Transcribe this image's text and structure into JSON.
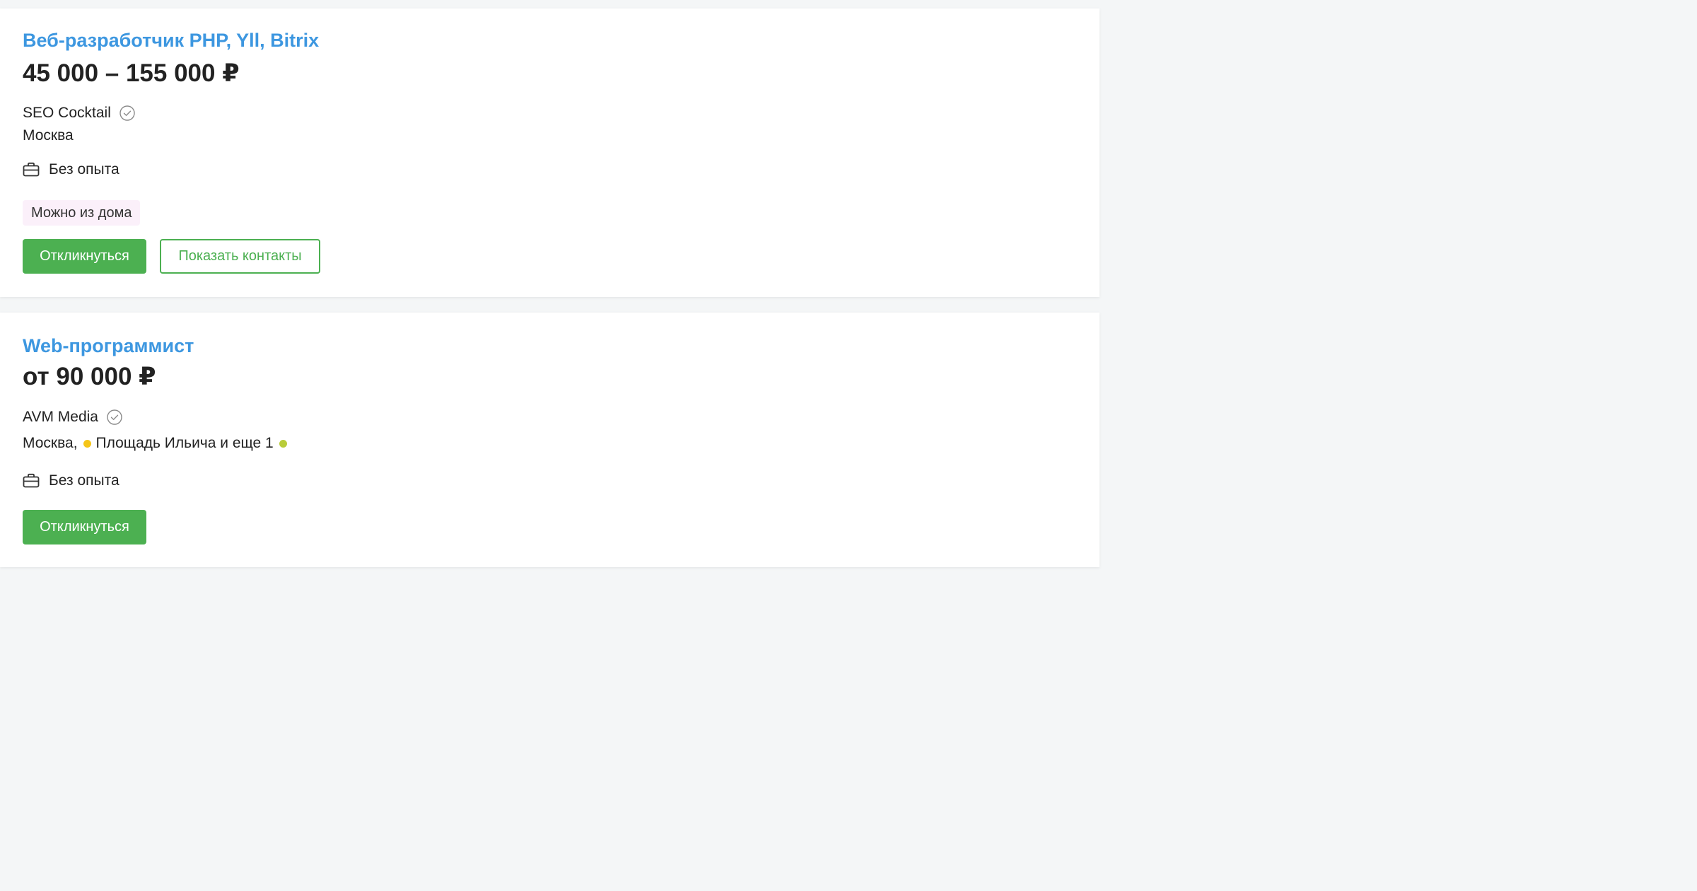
{
  "vacancies": [
    {
      "title": "Веб-разработчик PHP, Yll, Bitrix",
      "salary": "45 000 – 155 000 ₽",
      "company": "SEO Cocktail",
      "city": "Москва",
      "experience": "Без опыта",
      "tag": "Можно из дома",
      "respond_label": "Откликнуться",
      "contacts_label": "Показать контакты"
    },
    {
      "title": "Web-программист",
      "salary": "от 90 000 ₽",
      "company": "AVM Media",
      "city": "Москва,",
      "metro": "Площадь Ильича и еще 1",
      "metro_colors": [
        "#f5c518",
        "#b8cc3a"
      ],
      "experience": "Без опыта",
      "respond_label": "Откликнуться"
    }
  ],
  "icons": {
    "verified": "check-circle-icon",
    "experience": "briefcase-icon"
  }
}
